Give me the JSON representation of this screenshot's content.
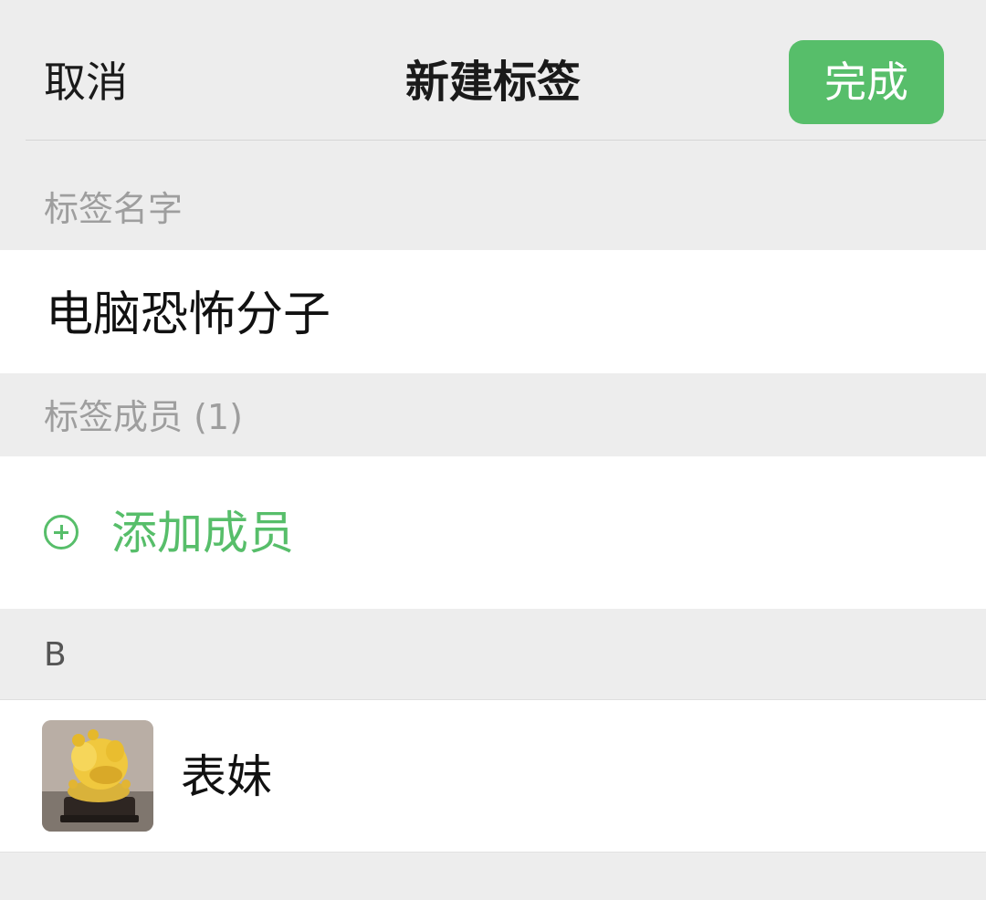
{
  "navbar": {
    "cancel_label": "取消",
    "title": "新建标签",
    "done_label": "完成"
  },
  "tag_name": {
    "section_label": "标签名字",
    "value": "电脑恐怖分子"
  },
  "members": {
    "section_label": "标签成员 (1)",
    "add_label": "添加成员",
    "add_icon": "plus-circle-icon"
  },
  "contacts": {
    "index_letter": "B",
    "items": [
      {
        "name": "表妹",
        "avatar": "golden-pig-statue-photo"
      }
    ]
  },
  "colors": {
    "accent_green": "#57be6a",
    "background": "#ededed",
    "row_background": "#ffffff",
    "secondary_text": "#9e9e9e"
  }
}
